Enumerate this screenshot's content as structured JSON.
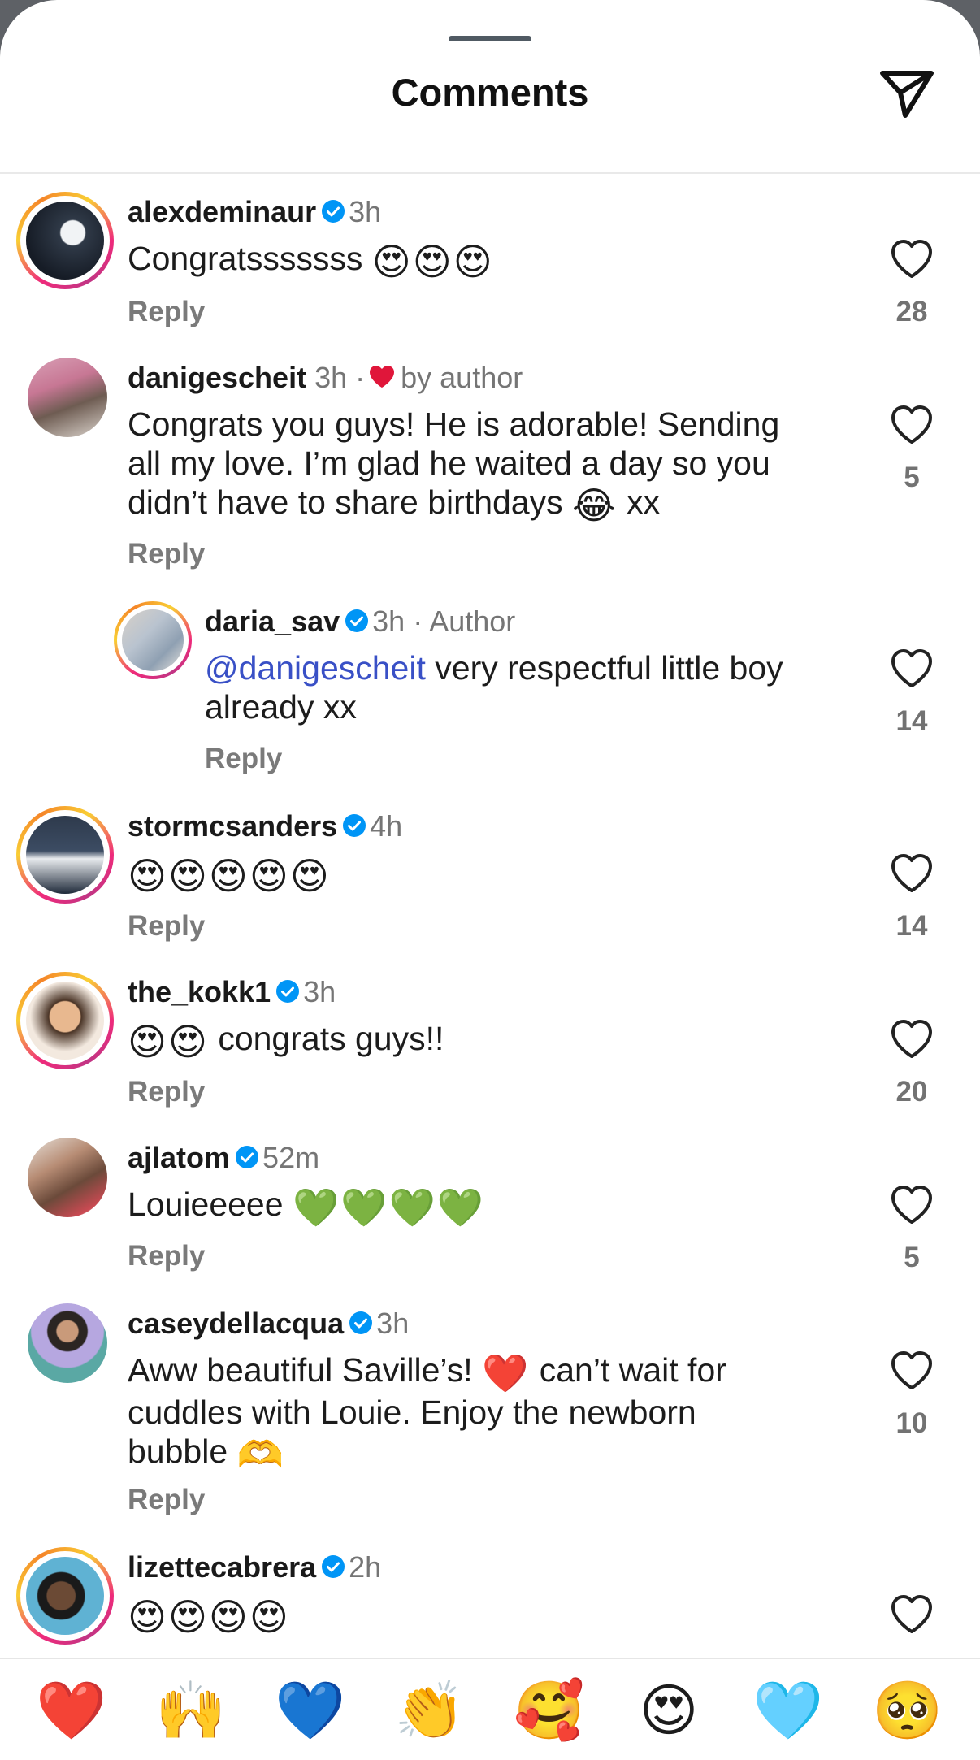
{
  "header": {
    "title": "Comments",
    "share_icon": "paper-plane-icon"
  },
  "comments": [
    {
      "user": "alexdeminaur",
      "verified": true,
      "time": "3h",
      "text": "Congratsssssss",
      "emoji": "😍😍😍",
      "reply": "Reply",
      "likes": "28"
    },
    {
      "user": "danigescheit",
      "verified": false,
      "time": "3h",
      "dot": "·",
      "liked_by": "by author",
      "line1": "Congrats you guys! He is adorable! Sending",
      "line2": "all my love. I’m glad he waited a day so you",
      "line3": "didn’t have to share birthdays",
      "emoji": "😂",
      "tail": "xx",
      "reply": "Reply",
      "likes": "5"
    },
    {
      "user": "daria_sav",
      "verified": true,
      "time": "3h",
      "badge": "· Author",
      "mention": "@danigescheit",
      "line1": "very respectful little boy",
      "line2": "already xx",
      "reply": "Reply",
      "likes": "14"
    },
    {
      "user": "stormcsanders",
      "verified": true,
      "time": "4h",
      "emoji": "😍😍😍😍😍",
      "reply": "Reply",
      "likes": "14"
    },
    {
      "user": "the_kokk1",
      "verified": true,
      "time": "3h",
      "emoji": "😍😍",
      "text": "congrats guys!!",
      "reply": "Reply",
      "likes": "20"
    },
    {
      "user": "ajlatom",
      "verified": true,
      "time": "52m",
      "text": "Louieeeee",
      "emoji": "💚💚💚💚",
      "reply": "Reply",
      "likes": "5"
    },
    {
      "user": "caseydellacqua",
      "verified": true,
      "time": "3h",
      "line1a": "Aww beautiful Saville’s!",
      "emoji1": "❤️",
      "line1b": "can’t wait for",
      "line2": "cuddles with Louie. Enjoy the newborn",
      "line3": "bubble",
      "emoji2": "🫶",
      "reply": "Reply",
      "likes": "10"
    },
    {
      "user": "lizettecabrera",
      "verified": true,
      "time": "2h",
      "emoji": "😍😍😍😍"
    }
  ],
  "reactions": [
    "❤️",
    "🙌",
    "💙",
    "👏",
    "🥰",
    "😍",
    "🩵",
    "🥺"
  ],
  "colors": {
    "verified": "#0095f6",
    "liked_heart": "#e0163a",
    "mention": "#3950c6"
  }
}
